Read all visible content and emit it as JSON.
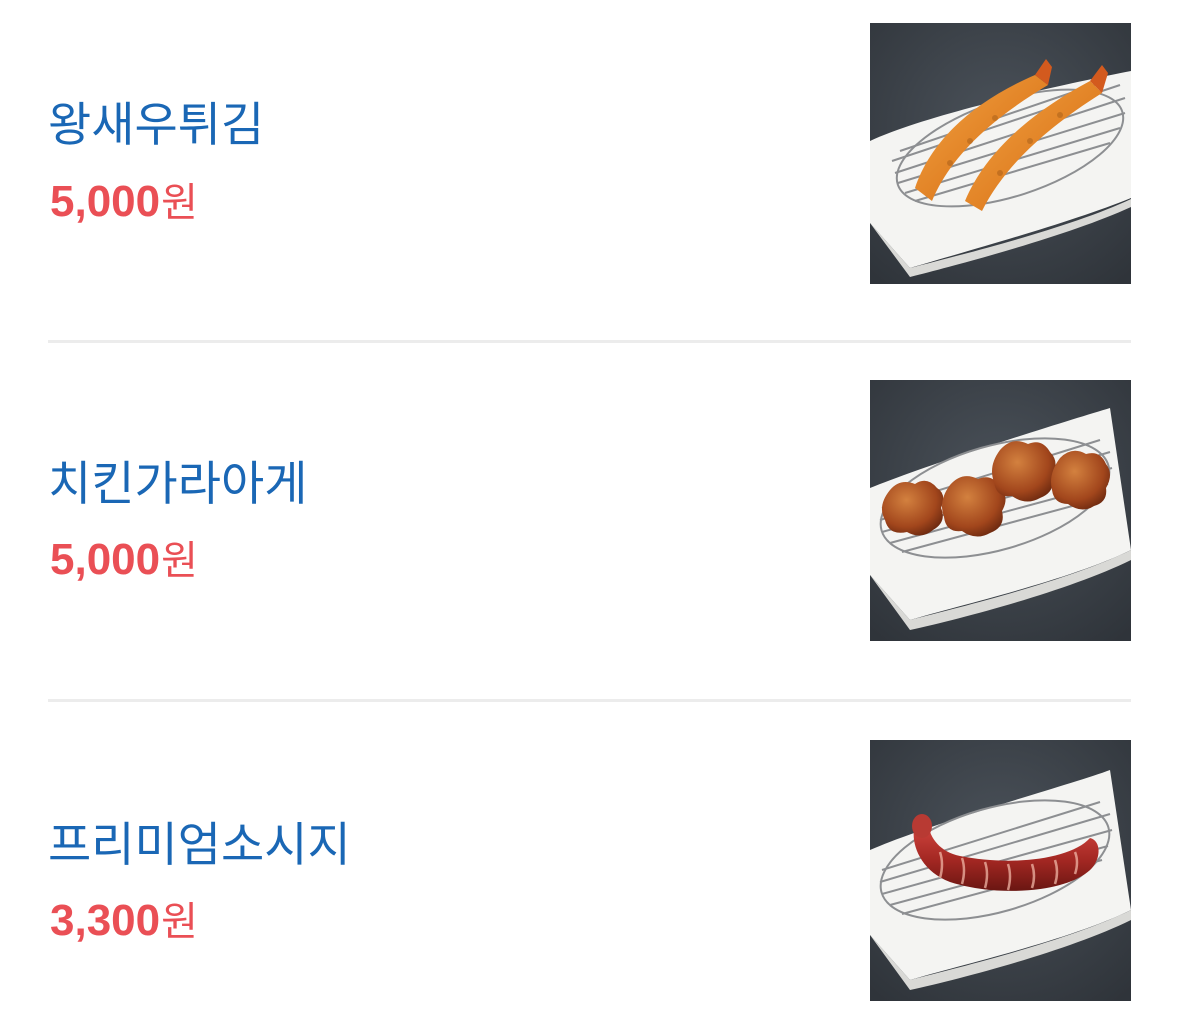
{
  "menu": {
    "items": [
      {
        "name": "왕새우튀김",
        "price_number": "5,000",
        "price_unit": "원",
        "image_icon": "fried-shrimp-image"
      },
      {
        "name": "치킨가라아게",
        "price_number": "5,000",
        "price_unit": "원",
        "image_icon": "chicken-karaage-image"
      },
      {
        "name": "프리미엄소시지",
        "price_number": "3,300",
        "price_unit": "원",
        "image_icon": "premium-sausage-image"
      }
    ]
  },
  "colors": {
    "name_blue": "#1a67b5",
    "price_red": "#ea4f55",
    "divider_gray": "#ececec",
    "photo_background": "#3d434a",
    "plate_white": "#f4f4f2"
  }
}
